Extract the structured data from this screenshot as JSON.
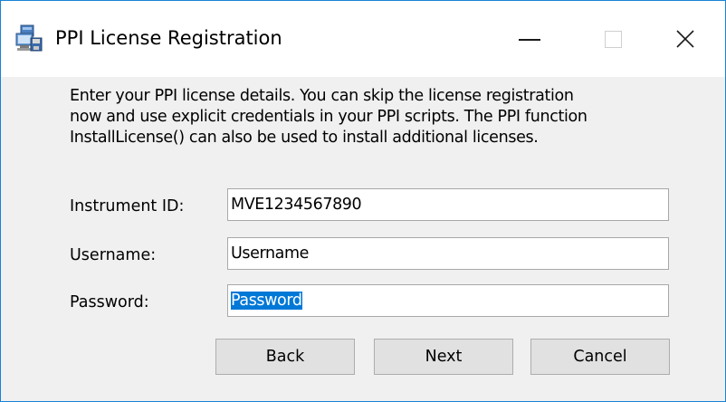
{
  "window": {
    "title": "PPI License Registration",
    "icon": "installer-icon"
  },
  "intro": {
    "lines": [
      "Enter your PPI license details. You can skip the license registration",
      "now and use explicit credentials in your PPI scripts. The PPI function",
      "InstallLicense() can also be used to install additional licenses."
    ]
  },
  "form": {
    "instrument_id": {
      "label": "Instrument ID:",
      "value": "MVE1234567890"
    },
    "username": {
      "label": "Username:",
      "value": "Username"
    },
    "password": {
      "label": "Password:",
      "value": "Password"
    }
  },
  "buttons": {
    "back": "Back",
    "next": "Next",
    "cancel": "Cancel"
  },
  "colors": {
    "accent": "#0078d7",
    "window_border": "#1883d7",
    "button_face": "#e1e1e1",
    "dialog_bg": "#f0f0f0"
  }
}
